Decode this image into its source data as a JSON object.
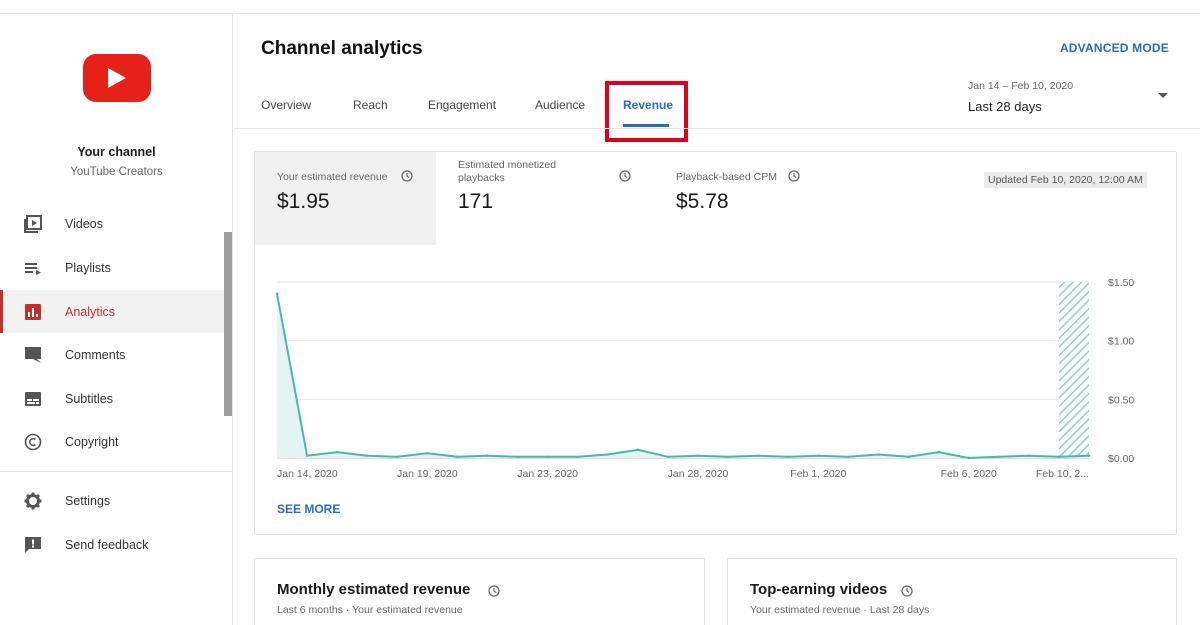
{
  "sidebar": {
    "channel_name": "Your channel",
    "channel_subtitle": "YouTube Creators",
    "items": [
      {
        "label": "Videos",
        "icon": "videos-icon"
      },
      {
        "label": "Playlists",
        "icon": "playlists-icon"
      },
      {
        "label": "Analytics",
        "icon": "analytics-icon",
        "active": true
      },
      {
        "label": "Comments",
        "icon": "comments-icon"
      },
      {
        "label": "Subtitles",
        "icon": "subtitles-icon"
      },
      {
        "label": "Copyright",
        "icon": "copyright-icon"
      },
      {
        "label": "Settings",
        "icon": "gear-icon"
      },
      {
        "label": "Send feedback",
        "icon": "feedback-icon"
      }
    ]
  },
  "header": {
    "title": "Channel analytics",
    "advanced_mode": "ADVANCED MODE",
    "tabs": [
      {
        "label": "Overview"
      },
      {
        "label": "Reach"
      },
      {
        "label": "Engagement"
      },
      {
        "label": "Audience"
      },
      {
        "label": "Revenue",
        "active": true
      }
    ],
    "date_range": "Jan 14 – Feb 10, 2020",
    "date_label": "Last 28 days"
  },
  "metrics": [
    {
      "label": "Your estimated revenue",
      "value": "$1.95"
    },
    {
      "label": "Estimated monetized playbacks",
      "value": "171"
    },
    {
      "label": "Playback-based CPM",
      "value": "$5.78"
    }
  ],
  "updated_text": "Updated Feb 10, 2020, 12:00 AM",
  "see_more": "SEE MORE",
  "chart_data": {
    "type": "area",
    "title": "",
    "xlabel": "",
    "ylabel": "",
    "ylim": [
      0,
      1.5
    ],
    "y_ticks": [
      "$0.00",
      "$0.50",
      "$1.00",
      "$1.50"
    ],
    "x_tick_labels": [
      "Jan 14, 2020",
      "Jan 19, 2020",
      "Jan 23, 2020",
      "Jan 28, 2020",
      "Feb 1, 2020",
      "Feb 6, 2020",
      "Feb 10, 2..."
    ],
    "x_dates": [
      "Jan 14",
      "Jan 15",
      "Jan 16",
      "Jan 17",
      "Jan 18",
      "Jan 19",
      "Jan 20",
      "Jan 21",
      "Jan 22",
      "Jan 23",
      "Jan 24",
      "Jan 25",
      "Jan 26",
      "Jan 27",
      "Jan 28",
      "Jan 29",
      "Jan 30",
      "Jan 31",
      "Feb 1",
      "Feb 2",
      "Feb 3",
      "Feb 4",
      "Feb 5",
      "Feb 6",
      "Feb 7",
      "Feb 8",
      "Feb 9",
      "Feb 10"
    ],
    "values": [
      1.4,
      0.02,
      0.05,
      0.02,
      0.01,
      0.04,
      0.01,
      0.02,
      0.01,
      0.01,
      0.01,
      0.03,
      0.07,
      0.01,
      0.02,
      0.01,
      0.02,
      0.01,
      0.02,
      0.01,
      0.03,
      0.01,
      0.05,
      0.0,
      0.01,
      0.02,
      0.01,
      0.02
    ],
    "line_color": "#4db6ac",
    "fill_color": "#e3f4f3",
    "grid": true,
    "partial_last_day_hatched": true
  },
  "bottom_cards": [
    {
      "title": "Monthly estimated revenue",
      "subtitle": "Last 6 months · Your estimated revenue"
    },
    {
      "title": "Top-earning videos",
      "subtitle": "Your estimated revenue · Last 28 days"
    }
  ],
  "colors": {
    "accent_blue": "#2a6ac4",
    "active_red": "#c4302b",
    "logo_red": "#e62117",
    "highlight_box": "#e0001b"
  }
}
